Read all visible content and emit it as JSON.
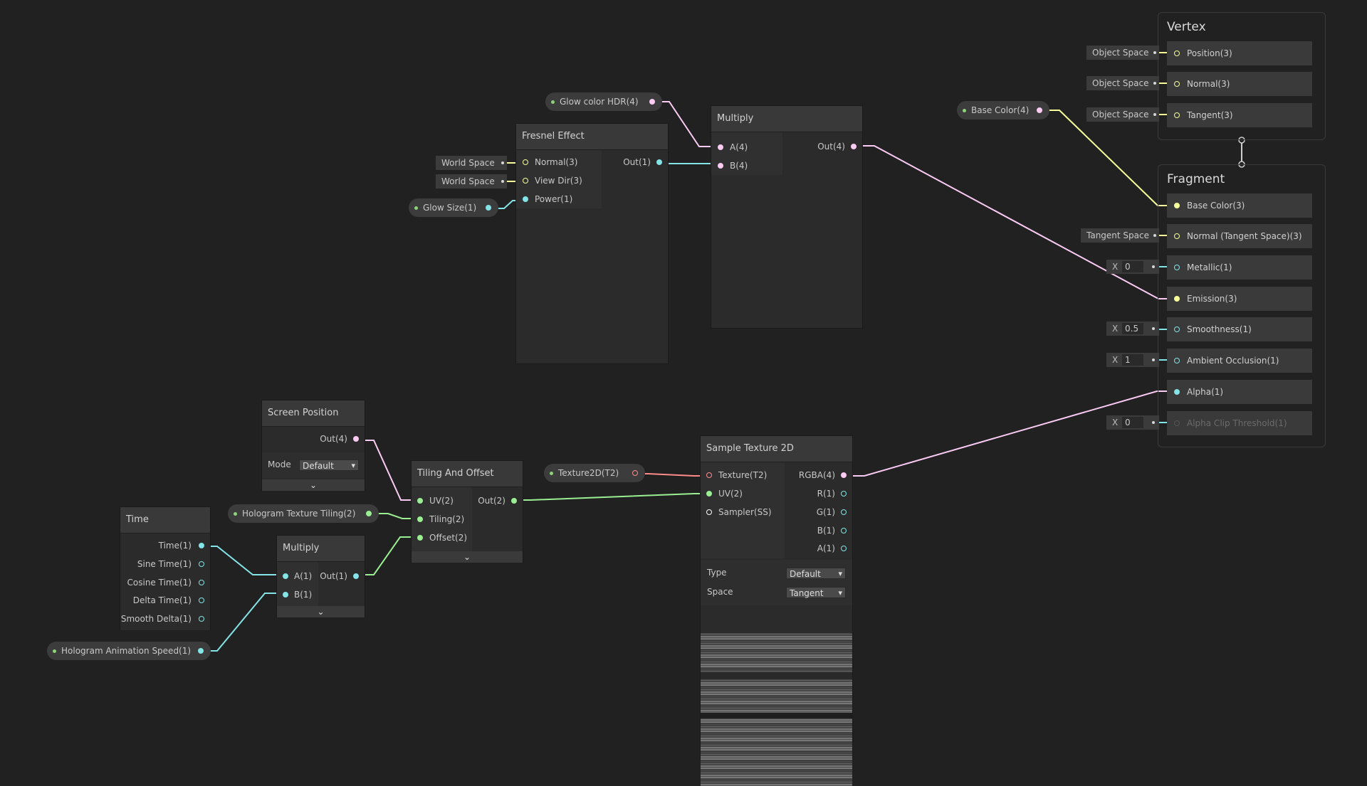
{
  "colors": {
    "float": "#84e4e7",
    "vector2": "#9aef92",
    "vector3": "#f6ff9a",
    "vector4": "#fbcbf4",
    "texture": "#ff8b8b",
    "sampler": "#ffffff",
    "background": "#212121"
  },
  "time_node": {
    "title": "Time",
    "outputs": [
      "Time(1)",
      "Sine Time(1)",
      "Cosine Time(1)",
      "Delta Time(1)",
      "Smooth Delta(1)"
    ]
  },
  "hologram_speed": {
    "label": "Hologram Animation Speed(1)"
  },
  "multiply_small": {
    "title": "Multiply",
    "in_a": "A(1)",
    "in_b": "B(1)",
    "out": "Out(1)"
  },
  "screen_position": {
    "title": "Screen Position",
    "out": "Out(4)",
    "mode_label": "Mode",
    "mode_value": "Default"
  },
  "hologram_tiling": {
    "label": "Hologram Texture Tiling(2)"
  },
  "tiling_offset": {
    "title": "Tiling And Offset",
    "in_uv": "UV(2)",
    "in_tiling": "Tiling(2)",
    "in_offset": "Offset(2)",
    "out": "Out(2)"
  },
  "texture_prop": {
    "label": "Texture2D(T2)"
  },
  "sample_texture": {
    "title": "Sample Texture 2D",
    "in_texture": "Texture(T2)",
    "in_uv": "UV(2)",
    "in_sampler": "Sampler(SS)",
    "outputs": [
      "RGBA(4)",
      "R(1)",
      "G(1)",
      "B(1)",
      "A(1)"
    ],
    "type_label": "Type",
    "type_value": "Default",
    "space_label": "Space",
    "space_value": "Tangent"
  },
  "glow_color": {
    "label": "Glow color HDR(4)"
  },
  "glow_size": {
    "label": "Glow Size(1)"
  },
  "fresnel": {
    "title": "Fresnel Effect",
    "in_normal": "Normal(3)",
    "in_viewdir": "View Dir(3)",
    "in_power": "Power(1)",
    "out": "Out(1)",
    "normal_space": "World Space",
    "viewdir_space": "World Space"
  },
  "multiply_big": {
    "title": "Multiply",
    "in_a": "A(4)",
    "in_b": "B(4)",
    "out": "Out(4)"
  },
  "base_color_prop": {
    "label": "Base Color(4)"
  },
  "vertex": {
    "title": "Vertex",
    "slots": [
      {
        "label": "Position(3)",
        "tag": "Object Space"
      },
      {
        "label": "Normal(3)",
        "tag": "Object Space"
      },
      {
        "label": "Tangent(3)",
        "tag": "Object Space"
      }
    ]
  },
  "fragment": {
    "title": "Fragment",
    "base_color": "Base Color(3)",
    "normal": "Normal (Tangent Space)(3)",
    "normal_tag": "Tangent Space",
    "metallic": "Metallic(1)",
    "metallic_x": "X",
    "metallic_value": "0",
    "emission": "Emission(3)",
    "smoothness": "Smoothness(1)",
    "smoothness_x": "X",
    "smoothness_value": "0.5",
    "ao": "Ambient Occlusion(1)",
    "ao_x": "X",
    "ao_value": "1",
    "alpha": "Alpha(1)",
    "alpha_clip": "Alpha Clip Threshold(1)",
    "alpha_clip_x": "X",
    "alpha_clip_value": "0"
  }
}
